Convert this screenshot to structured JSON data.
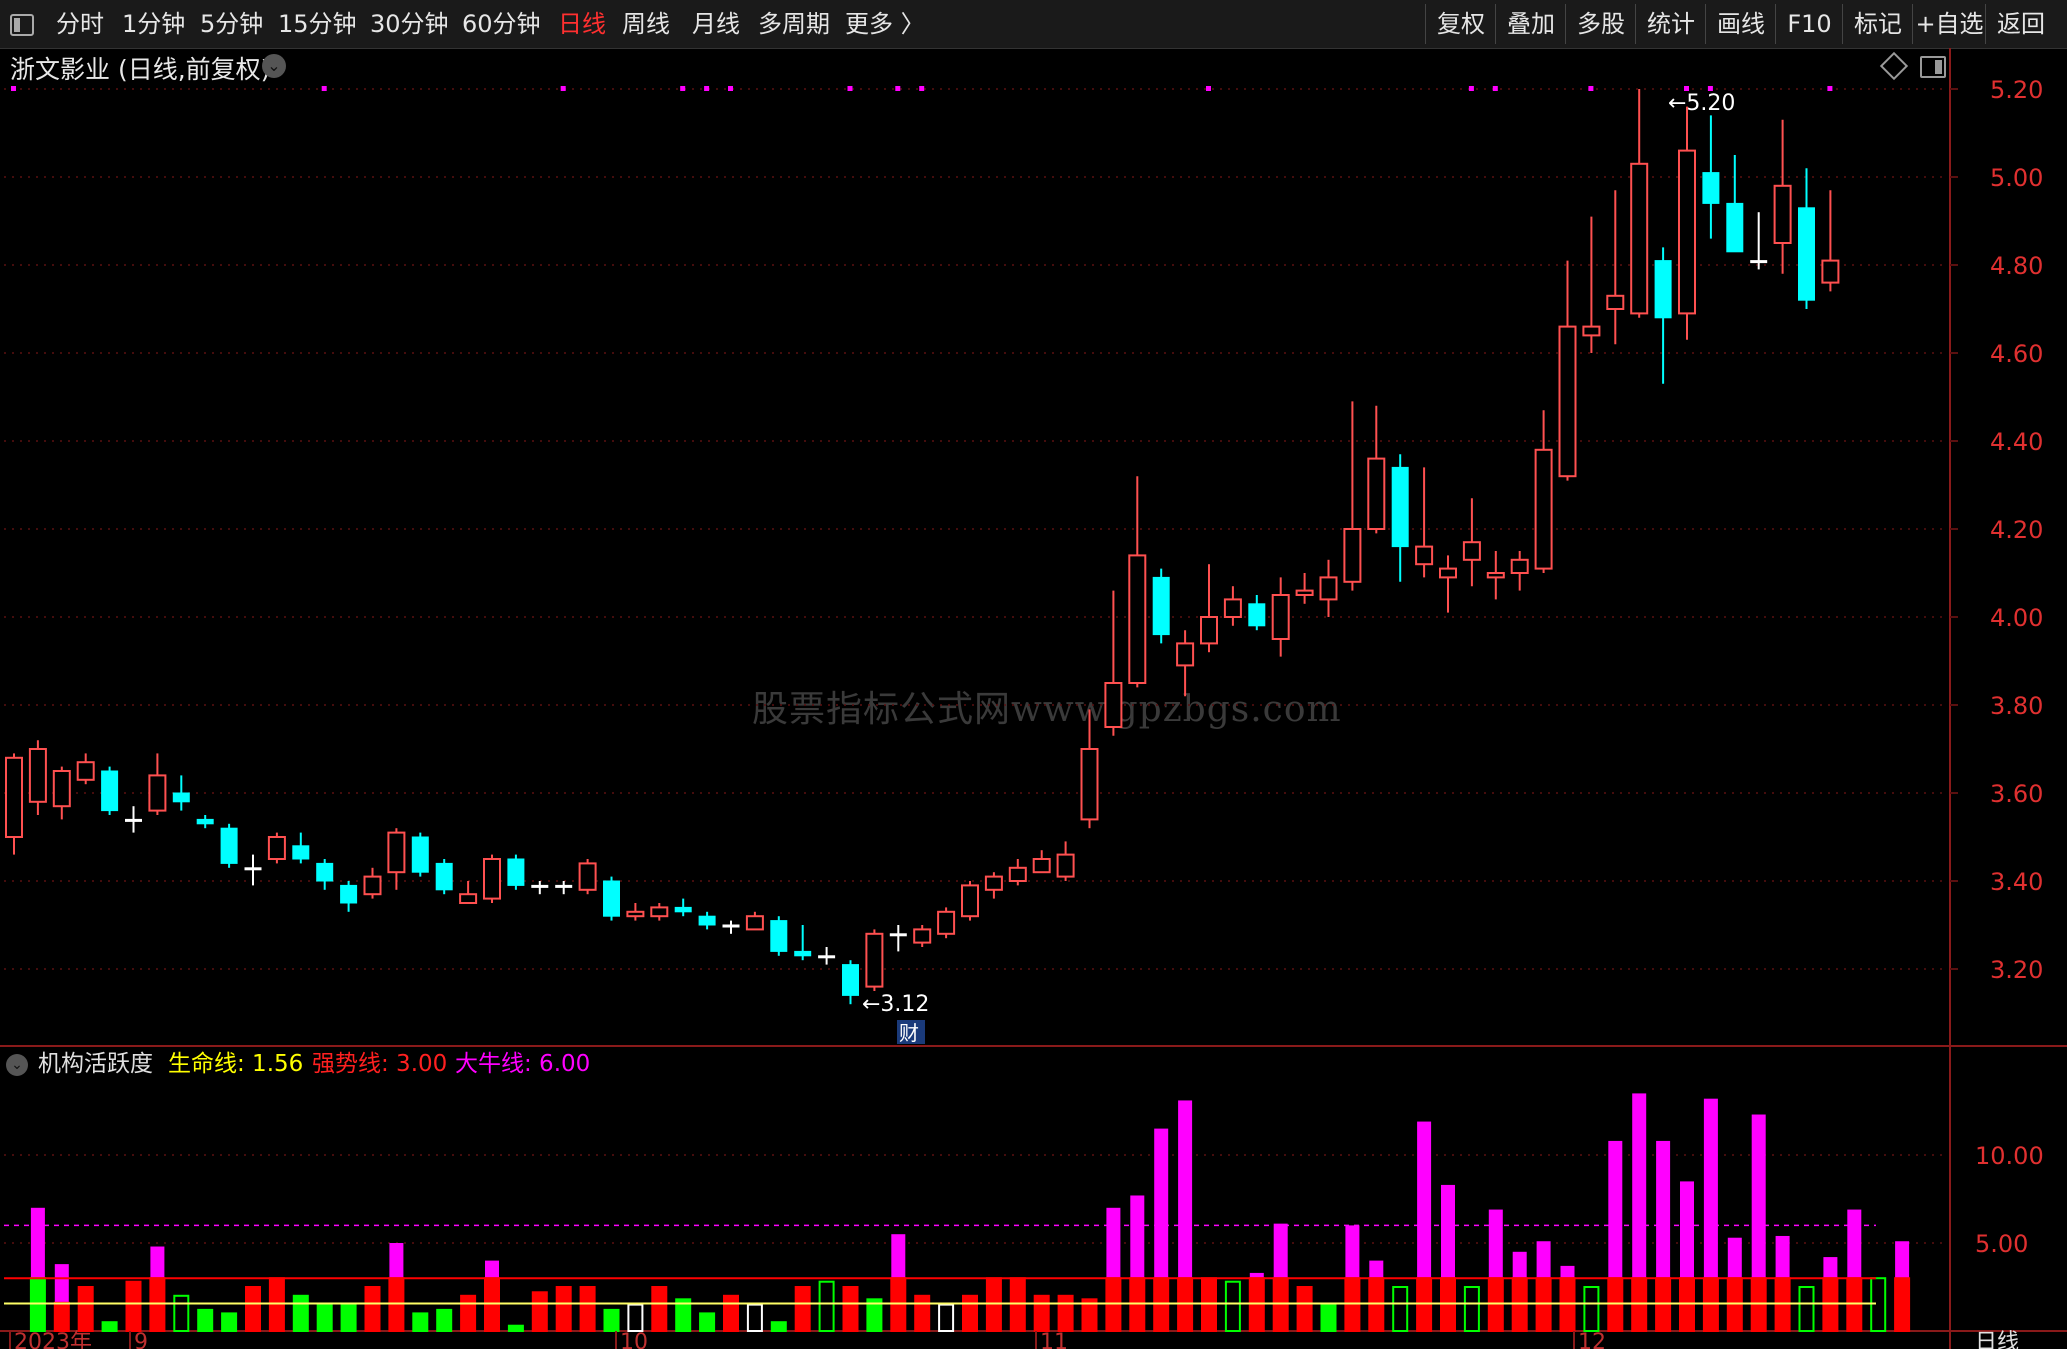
{
  "toolbar": {
    "periods": [
      "分时",
      "1分钟",
      "5分钟",
      "15分钟",
      "30分钟",
      "60分钟",
      "日线",
      "周线",
      "月线",
      "多周期",
      "更多 〉"
    ],
    "active_period": "日线",
    "right_buttons": [
      "复权",
      "叠加",
      "多股",
      "统计",
      "画线",
      "F10",
      "标记",
      "+自选",
      "返回"
    ]
  },
  "stock": {
    "title": "浙文影业 (日线,前复权)",
    "high_label": "5.20",
    "low_label": "3.12",
    "finance_badge": "财"
  },
  "watermark": "股票指标公式网www.gpzbgs.com",
  "indicator": {
    "name": "机构活跃度",
    "lines": [
      {
        "label": "生命线: 1.56",
        "color": "#ffff00"
      },
      {
        "label": "强势线: 3.00",
        "color": "#ff2020"
      },
      {
        "label": "大牛线: 6.00",
        "color": "#ff00ff"
      }
    ]
  },
  "price_axis": {
    "ticks": [
      "5.20",
      "5.00",
      "4.80",
      "4.60",
      "4.40",
      "4.20",
      "4.00",
      "3.80",
      "3.60",
      "3.40",
      "3.20"
    ],
    "min": 3.2,
    "max": 5.2,
    "color": "#e03030"
  },
  "indicator_axis": {
    "ticks": [
      "10.00",
      "5.00"
    ],
    "min": 0,
    "max": 10
  },
  "date_axis": {
    "labels": [
      "2023年",
      "9",
      "10",
      "11",
      "12"
    ],
    "period_label": "日线"
  },
  "colors": {
    "up": "#ff5050",
    "down": "#00ffff",
    "doji": "#ffffff",
    "grid": "#5a1010",
    "mag": "#ff00ff",
    "red": "#ff0000",
    "green": "#00ff00",
    "yellow": "#ffff66"
  },
  "chart_data": {
    "type": "candlestick",
    "candles": [
      [
        3.5,
        3.68,
        3.46,
        3.69
      ],
      [
        3.58,
        3.7,
        3.55,
        3.72
      ],
      [
        3.57,
        3.65,
        3.54,
        3.66
      ],
      [
        3.63,
        3.67,
        3.62,
        3.69
      ],
      [
        3.65,
        3.56,
        3.55,
        3.66
      ],
      [
        3.54,
        3.54,
        3.51,
        3.57
      ],
      [
        3.56,
        3.64,
        3.55,
        3.69
      ],
      [
        3.6,
        3.58,
        3.56,
        3.64
      ],
      [
        3.54,
        3.53,
        3.52,
        3.55
      ],
      [
        3.52,
        3.44,
        3.43,
        3.53
      ],
      [
        3.43,
        3.43,
        3.39,
        3.46
      ],
      [
        3.45,
        3.5,
        3.44,
        3.51
      ],
      [
        3.48,
        3.45,
        3.44,
        3.51
      ],
      [
        3.44,
        3.4,
        3.38,
        3.45
      ],
      [
        3.39,
        3.35,
        3.33,
        3.4
      ],
      [
        3.37,
        3.41,
        3.36,
        3.43
      ],
      [
        3.42,
        3.51,
        3.38,
        3.52
      ],
      [
        3.5,
        3.42,
        3.41,
        3.51
      ],
      [
        3.44,
        3.38,
        3.37,
        3.45
      ],
      [
        3.35,
        3.37,
        3.35,
        3.4
      ],
      [
        3.36,
        3.45,
        3.35,
        3.46
      ],
      [
        3.45,
        3.39,
        3.38,
        3.46
      ],
      [
        3.39,
        3.39,
        3.37,
        3.4
      ],
      [
        3.39,
        3.39,
        3.37,
        3.4
      ],
      [
        3.38,
        3.44,
        3.37,
        3.45
      ],
      [
        3.4,
        3.32,
        3.31,
        3.41
      ],
      [
        3.32,
        3.33,
        3.31,
        3.35
      ],
      [
        3.32,
        3.34,
        3.31,
        3.35
      ],
      [
        3.34,
        3.33,
        3.32,
        3.36
      ],
      [
        3.32,
        3.3,
        3.29,
        3.33
      ],
      [
        3.3,
        3.3,
        3.28,
        3.31
      ],
      [
        3.29,
        3.32,
        3.29,
        3.33
      ],
      [
        3.31,
        3.24,
        3.23,
        3.32
      ],
      [
        3.24,
        3.23,
        3.22,
        3.3
      ],
      [
        3.23,
        3.23,
        3.21,
        3.25
      ],
      [
        3.21,
        3.14,
        3.12,
        3.22
      ],
      [
        3.16,
        3.28,
        3.15,
        3.29
      ],
      [
        3.28,
        3.28,
        3.24,
        3.3
      ],
      [
        3.26,
        3.29,
        3.25,
        3.3
      ],
      [
        3.28,
        3.33,
        3.27,
        3.34
      ],
      [
        3.32,
        3.39,
        3.31,
        3.4
      ],
      [
        3.38,
        3.41,
        3.36,
        3.42
      ],
      [
        3.4,
        3.43,
        3.39,
        3.45
      ],
      [
        3.42,
        3.45,
        3.42,
        3.47
      ],
      [
        3.41,
        3.46,
        3.4,
        3.49
      ],
      [
        3.54,
        3.7,
        3.52,
        3.79
      ],
      [
        3.75,
        3.85,
        3.73,
        4.06
      ],
      [
        3.85,
        4.14,
        3.84,
        4.32
      ],
      [
        4.09,
        3.96,
        3.94,
        4.11
      ],
      [
        3.89,
        3.94,
        3.82,
        3.97
      ],
      [
        3.94,
        4.0,
        3.92,
        4.12
      ],
      [
        4.0,
        4.04,
        3.98,
        4.07
      ],
      [
        4.03,
        3.98,
        3.97,
        4.05
      ],
      [
        3.95,
        4.05,
        3.91,
        4.09
      ],
      [
        4.05,
        4.06,
        4.03,
        4.1
      ],
      [
        4.04,
        4.09,
        4.0,
        4.13
      ],
      [
        4.08,
        4.2,
        4.06,
        4.49
      ],
      [
        4.2,
        4.36,
        4.19,
        4.48
      ],
      [
        4.34,
        4.16,
        4.08,
        4.37
      ],
      [
        4.12,
        4.16,
        4.09,
        4.34
      ],
      [
        4.09,
        4.11,
        4.01,
        4.14
      ],
      [
        4.13,
        4.17,
        4.07,
        4.27
      ],
      [
        4.09,
        4.1,
        4.04,
        4.15
      ],
      [
        4.1,
        4.13,
        4.06,
        4.15
      ],
      [
        4.11,
        4.38,
        4.1,
        4.47
      ],
      [
        4.32,
        4.66,
        4.31,
        4.81
      ],
      [
        4.64,
        4.66,
        4.6,
        4.91
      ],
      [
        4.7,
        4.73,
        4.62,
        4.97
      ],
      [
        4.69,
        5.03,
        4.68,
        5.2
      ],
      [
        4.81,
        4.68,
        4.53,
        4.84
      ],
      [
        4.69,
        5.06,
        4.63,
        5.16
      ],
      [
        5.01,
        4.94,
        4.86,
        5.14
      ],
      [
        4.94,
        4.83,
        4.83,
        5.05
      ],
      [
        4.81,
        4.81,
        4.79,
        4.92
      ],
      [
        4.85,
        4.98,
        4.78,
        5.13
      ],
      [
        4.93,
        4.72,
        4.7,
        5.02
      ],
      [
        4.76,
        4.81,
        4.74,
        4.97
      ]
    ],
    "activity": [
      [
        0,
        "g",
        null
      ],
      [
        3,
        "g",
        7
      ],
      [
        1.6,
        "r",
        3.8
      ],
      [
        2.5,
        "r",
        null
      ],
      [
        0.5,
        "g",
        null
      ],
      [
        2.8,
        "r",
        null
      ],
      [
        3,
        "r",
        4.8
      ],
      [
        2,
        "g_hollow",
        null
      ],
      [
        1.2,
        "g",
        null
      ],
      [
        1,
        "g",
        null
      ],
      [
        2.5,
        "r",
        null
      ],
      [
        3,
        "r",
        null
      ],
      [
        2,
        "g",
        null
      ],
      [
        1.5,
        "g",
        null
      ],
      [
        1.5,
        "g",
        null
      ],
      [
        2.5,
        "r",
        null
      ],
      [
        3,
        "r",
        5
      ],
      [
        1,
        "g",
        null
      ],
      [
        1.2,
        "g",
        null
      ],
      [
        2,
        "r",
        null
      ],
      [
        3,
        "r",
        4
      ],
      [
        0.3,
        "g",
        null
      ],
      [
        2.2,
        "r",
        null
      ],
      [
        2.5,
        "r",
        null
      ],
      [
        2.5,
        "r",
        null
      ],
      [
        1.2,
        "g",
        null
      ],
      [
        1.5,
        "w_hollow",
        null
      ],
      [
        2.5,
        "r",
        null
      ],
      [
        1.8,
        "g",
        null
      ],
      [
        1,
        "g",
        null
      ],
      [
        2,
        "r",
        null
      ],
      [
        1.5,
        "w_hollow",
        null
      ],
      [
        0.5,
        "g",
        null
      ],
      [
        2.5,
        "r",
        null
      ],
      [
        2.8,
        "g_hollow",
        null
      ],
      [
        2.5,
        "r",
        null
      ],
      [
        1.8,
        "g",
        null
      ],
      [
        3,
        "r",
        5.5
      ],
      [
        2,
        "r",
        null
      ],
      [
        1.5,
        "w_hollow",
        null
      ],
      [
        2,
        "r",
        null
      ],
      [
        3,
        "r",
        null
      ],
      [
        3,
        "r",
        null
      ],
      [
        2,
        "r",
        null
      ],
      [
        2,
        "r",
        null
      ],
      [
        1.8,
        "r",
        null
      ],
      [
        3,
        "r",
        7
      ],
      [
        3,
        "r",
        7.7
      ],
      [
        3,
        "r",
        11.5
      ],
      [
        3,
        "r",
        13.1
      ],
      [
        3,
        "r",
        null
      ],
      [
        2.8,
        "g_hollow",
        null
      ],
      [
        3,
        "r",
        3.3
      ],
      [
        3,
        "r",
        6.1
      ],
      [
        2.5,
        "r",
        null
      ],
      [
        1.5,
        "g",
        null
      ],
      [
        3,
        "r",
        6
      ],
      [
        3,
        "r",
        4
      ],
      [
        2.5,
        "g_hollow",
        null
      ],
      [
        3,
        "r",
        11.9
      ],
      [
        3,
        "r",
        8.3
      ],
      [
        2.5,
        "g_hollow",
        null
      ],
      [
        3,
        "r",
        6.9
      ],
      [
        3,
        "r",
        4.5
      ],
      [
        3,
        "r",
        5.1
      ],
      [
        3,
        "r",
        3.7
      ],
      [
        2.5,
        "g_hollow",
        null
      ],
      [
        3,
        "r",
        10.8
      ],
      [
        3,
        "r",
        13.5
      ],
      [
        3,
        "r",
        10.8
      ],
      [
        3,
        "r",
        8.5
      ],
      [
        3,
        "r",
        13.2
      ],
      [
        3,
        "r",
        5.3
      ],
      [
        3,
        "r",
        12.3
      ],
      [
        3,
        "r",
        5.4
      ],
      [
        2.5,
        "g_hollow",
        null
      ],
      [
        3,
        "r",
        4.2
      ],
      [
        3,
        "r",
        6.9
      ],
      [
        3,
        "g_hollow",
        null
      ],
      [
        3,
        "r",
        5.1
      ]
    ],
    "life_line": 1.56,
    "strong_line": 3.0,
    "bull_line": 6.0
  }
}
